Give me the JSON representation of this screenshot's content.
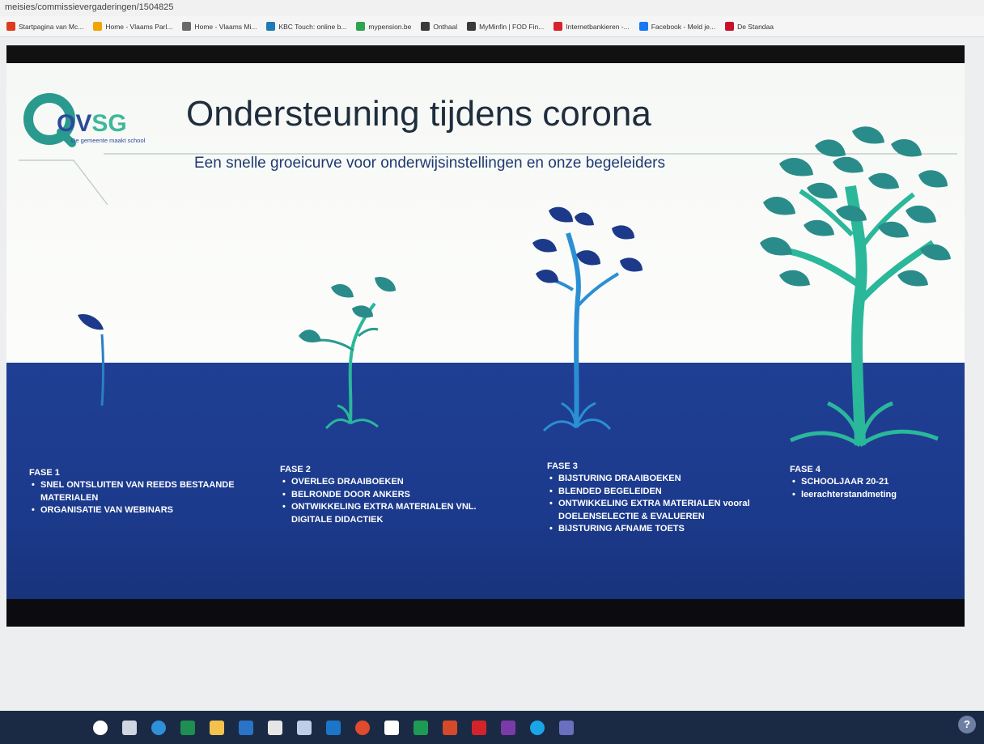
{
  "browser": {
    "url": "meisies/commissievergaderingen/1504825",
    "bookmarks": [
      {
        "label": "Startpagina van Mc...",
        "color": "#e03a1e"
      },
      {
        "label": "Home - Vlaams Parl...",
        "color": "#f0a500"
      },
      {
        "label": "Home - Vlaams Mi...",
        "color": "#6a6a6a"
      },
      {
        "label": "KBC Touch: online b...",
        "color": "#1f7ab8"
      },
      {
        "label": "mypension.be",
        "color": "#2ea44f"
      },
      {
        "label": "Onthaal",
        "color": "#3a3a3a"
      },
      {
        "label": "MyMinfin | FOD Fin...",
        "color": "#3a3a3a"
      },
      {
        "label": "Internetbankieren -...",
        "color": "#d8232a"
      },
      {
        "label": "Facebook - Meld je...",
        "color": "#1877f2"
      },
      {
        "label": "De Standaa",
        "color": "#c8102e"
      }
    ]
  },
  "slide": {
    "logo": {
      "text_ov": "OV",
      "text_sg": "SG",
      "tagline": "De gemeente maakt school"
    },
    "title": "Ondersteuning tijdens corona",
    "subtitle": "Een snelle groeicurve voor onderwijsinstellingen en onze begeleiders",
    "phases": [
      {
        "heading": "FASE 1",
        "items": [
          "SNEL ONTSLUITEN VAN REEDS BESTAANDE MATERIALEN",
          "ORGANISATIE VAN WEBINARS"
        ]
      },
      {
        "heading": "FASE 2",
        "items": [
          "OVERLEG DRAAIBOEKEN",
          "BELRONDE DOOR ANKERS",
          "ONTWIKKELING EXTRA MATERIALEN VNL. DIGITALE DIDACTIEK"
        ]
      },
      {
        "heading": "FASE 3",
        "items": [
          "BIJSTURING DRAAIBOEKEN",
          "BLENDED BEGELEIDEN",
          "ONTWIKKELING EXTRA MATERIALEN vooral DOELENSELECTIE & EVALUEREN",
          "BIJSTURING AFNAME TOETS"
        ]
      },
      {
        "heading": "FASE 4",
        "items": [
          "SCHOOLJAAR 20-21",
          "leerachterstandmeting"
        ]
      }
    ],
    "colors": {
      "blue_band": "#1f3f94",
      "teal": "#2a9a8e",
      "dark_blue_leaf": "#1d3a8a",
      "green": "#3fb89a"
    }
  },
  "taskbar": {
    "help_label": "?",
    "icons": [
      {
        "name": "search-icon",
        "color": "#ffffff"
      },
      {
        "name": "task-view-icon",
        "color": "#d0d6e0"
      },
      {
        "name": "edge-icon",
        "color": "#2f8fd8"
      },
      {
        "name": "excel-icon",
        "color": "#1d8f52"
      },
      {
        "name": "file-explorer-icon",
        "color": "#f2c14e"
      },
      {
        "name": "mail-icon",
        "color": "#2a73c9"
      },
      {
        "name": "amazon-icon",
        "color": "#e6e6e6"
      },
      {
        "name": "dropbox-icon",
        "color": "#bfcde8"
      },
      {
        "name": "outlook-icon",
        "color": "#1b76c9"
      },
      {
        "name": "chrome-icon",
        "color": "#e04a2f"
      },
      {
        "name": "dollar-icon",
        "color": "#ffffff"
      },
      {
        "name": "excel2-icon",
        "color": "#1f9a55"
      },
      {
        "name": "powerpoint-icon",
        "color": "#d64a2a"
      },
      {
        "name": "acrobat-icon",
        "color": "#d4242b"
      },
      {
        "name": "onenote-icon",
        "color": "#7a3aa8"
      },
      {
        "name": "skype-icon",
        "color": "#1aa6e6"
      },
      {
        "name": "teams-icon",
        "color": "#6b6fbf"
      }
    ]
  }
}
